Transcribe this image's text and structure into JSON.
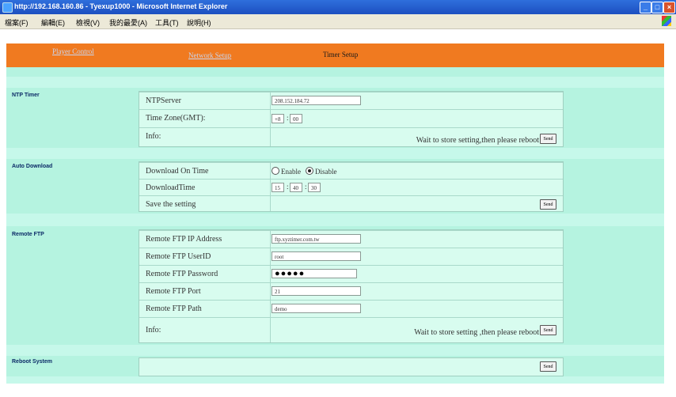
{
  "window": {
    "title": "http://192.168.160.86 - Tyexup1000 - Microsoft Internet Explorer"
  },
  "menu": [
    "檔案(F)",
    "編輯(E)",
    "檢視(V)",
    "我的最愛(A)",
    "工具(T)",
    "說明(H)"
  ],
  "nav": {
    "player_control": "Player Control",
    "network_setup": "Network Setup",
    "timer_setup": "Timer Setup"
  },
  "ntp": {
    "section": "NTP Timer",
    "server_label": "NTPServer",
    "server_value": "208.152.184.72",
    "tz_label": "Time Zone(GMT):",
    "tz_hour": "+8",
    "tz_min": "00",
    "info_label": "Info:",
    "info_msg": "Wait to store setting,then please reboot",
    "send": "Send"
  },
  "auto": {
    "section": "Auto Download",
    "ontime_label": "Download On Time",
    "enable": "Enable",
    "disable": "Disable",
    "selected": "Disable",
    "time_label": "DownloadTime",
    "hh": "15",
    "mm": "40",
    "ss": "30",
    "save_label": "Save the setting",
    "send": "Send"
  },
  "ftp": {
    "section": "Remote FTP",
    "ip_label": "Remote FTP IP Address",
    "ip_value": "ftp.xyztimer.com.tw",
    "user_label": "Remote FTP UserID",
    "user_value": "root",
    "pass_label": "Remote FTP Password",
    "pass_value": "●●●●●",
    "port_label": "Remote FTP Port",
    "port_value": "21",
    "path_label": "Remote FTP Path",
    "path_value": "demo",
    "info_label": "Info:",
    "info_msg": "Wait to store setting ,then please reboot",
    "send": "Send"
  },
  "reboot": {
    "section": "Reboot System",
    "send": "Send"
  }
}
